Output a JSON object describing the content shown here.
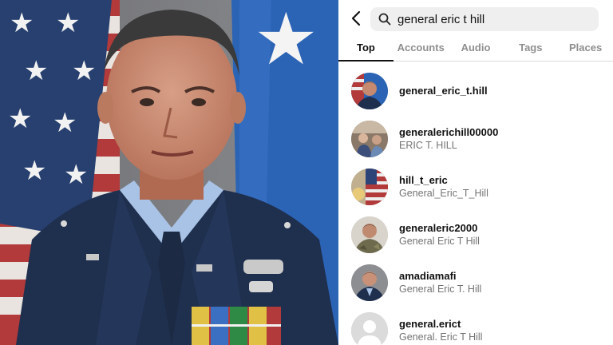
{
  "search": {
    "query": "general eric t hill",
    "back_icon": "chevron-left-icon",
    "search_icon": "magnifier-icon"
  },
  "tabs": [
    {
      "label": "Top",
      "active": true
    },
    {
      "label": "Accounts",
      "active": false
    },
    {
      "label": "Audio",
      "active": false
    },
    {
      "label": "Tags",
      "active": false
    },
    {
      "label": "Places",
      "active": false
    }
  ],
  "results": [
    {
      "username": "general_eric_t.hill",
      "full_name": ""
    },
    {
      "username": "generalerichill00000",
      "full_name": "ERIC T. HILL"
    },
    {
      "username": "hill_t_eric",
      "full_name": "General_Eric_T_Hill"
    },
    {
      "username": "generaleric2000",
      "full_name": "General Eric T Hill"
    },
    {
      "username": "amadiamafi",
      "full_name": "General Eric T. Hill"
    },
    {
      "username": "general.erict",
      "full_name": "General. Eric T Hill"
    }
  ],
  "photo": {
    "subject": "official-portrait-officer-in-blue-uniform",
    "colors": {
      "uniform": "#1f2f4e",
      "shirt": "#a9c3e6",
      "flag_blue": "#2b63b5",
      "backdrop": "#7b7c80"
    }
  }
}
